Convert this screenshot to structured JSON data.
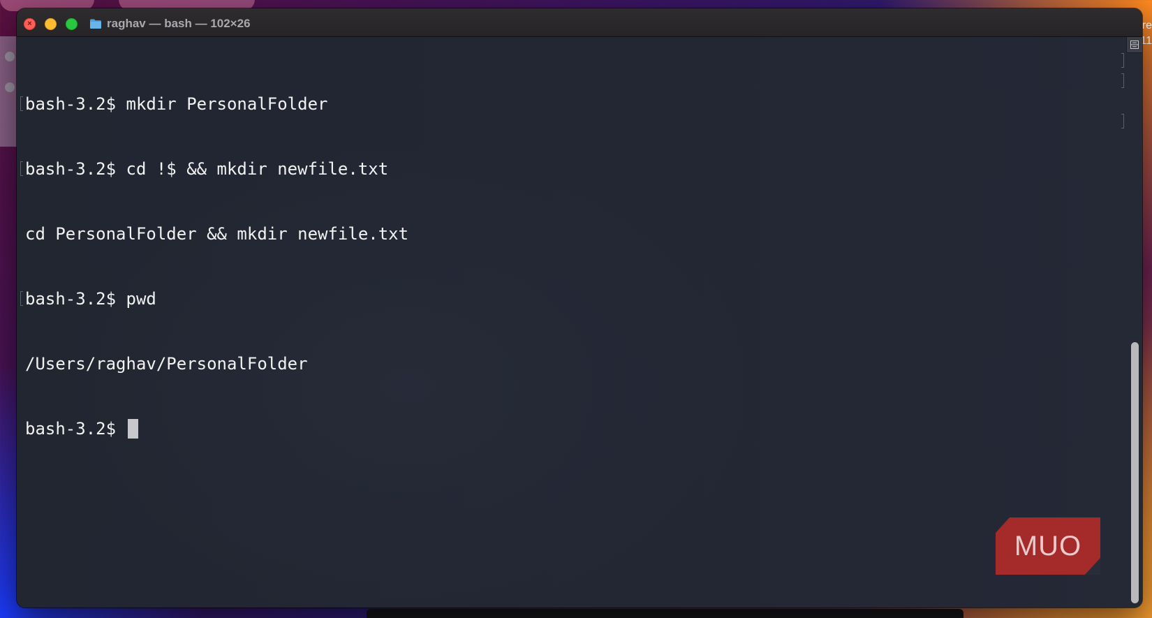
{
  "desktop": {
    "right_edge_text": "re\n11"
  },
  "window": {
    "title": "raghav — bash — 102×26",
    "title_icon": "folder-icon",
    "buttons": {
      "close": "close-button",
      "minimize": "minimize-button",
      "zoom": "zoom-button"
    }
  },
  "terminal": {
    "lines": [
      "bash-3.2$ mkdir PersonalFolder",
      "bash-3.2$ cd !$ && mkdir newfile.txt",
      "cd PersonalFolder && mkdir newfile.txt",
      "bash-3.2$ pwd",
      "/Users/raghav/PersonalFolder",
      "bash-3.2$ "
    ],
    "scroll_position": 0.44
  },
  "watermark": {
    "text": "MUO",
    "color": "#a52a2a"
  },
  "colors": {
    "terminal_background": "#232733",
    "terminal_text": "#f2f2f2",
    "close": "#ff5f57",
    "minimize": "#febc2e",
    "zoom": "#28c840"
  }
}
